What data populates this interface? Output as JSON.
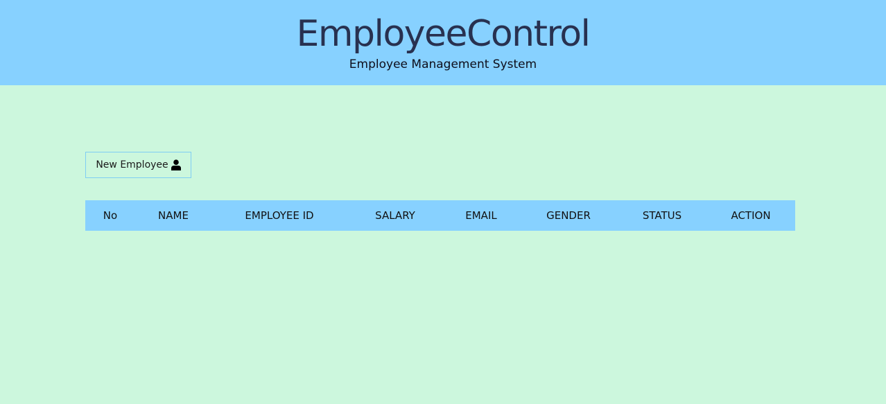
{
  "header": {
    "title": "EmployeeControl",
    "subtitle": "Employee Management System"
  },
  "toolbar": {
    "new_employee_label": "New Employee",
    "new_employee_icon": "user-icon"
  },
  "table": {
    "columns": [
      "No",
      "NAME",
      "EMPLOYEE ID",
      "SALARY",
      "EMAIL",
      "GENDER",
      "STATUS",
      "ACTION"
    ],
    "rows": []
  },
  "colors": {
    "header_bg": "#87d1ff",
    "page_bg": "#ccf7dd",
    "title": "#283150"
  }
}
